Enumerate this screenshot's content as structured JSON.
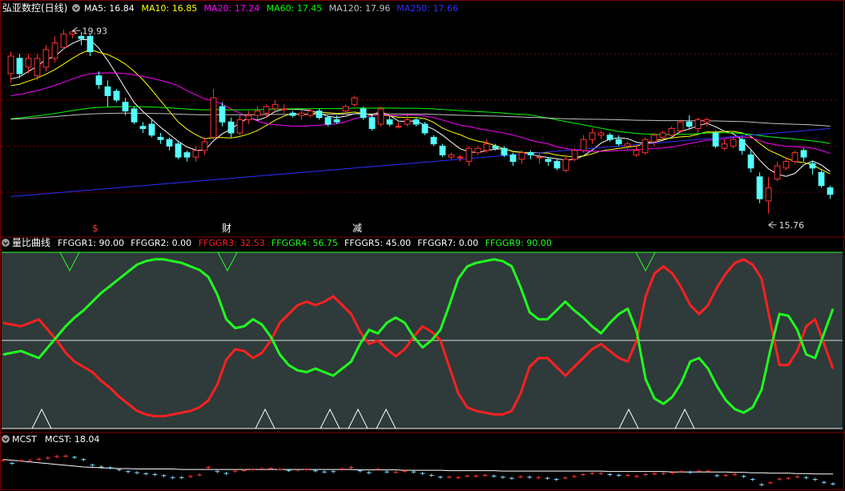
{
  "colors": {
    "up": "#ff3232",
    "down": "#54ffff",
    "ma5": "#ffffff",
    "ma10": "#ffff00",
    "ma20": "#ff00ff",
    "ma60": "#00ff00",
    "ma120": "#c0c0c0",
    "ma250": "#3030ff",
    "ffggr3": "#ff2020",
    "ffggr4": "#20ff20",
    "neutral": "#ffffff",
    "panel2_bg": "#2f3a3a",
    "border": "#800000"
  },
  "main": {
    "stock_name": "弘亚数控(日线)",
    "ma_labels": [
      {
        "label": "MA5: 16.84",
        "color": "#ffffff"
      },
      {
        "label": "MA10: 16.85",
        "color": "#ffff00"
      },
      {
        "label": "MA20: 17.24",
        "color": "#ff00ff"
      },
      {
        "label": "MA60: 17.45",
        "color": "#00ff00"
      },
      {
        "label": "MA120: 17.96",
        "color": "#c0c0c0"
      },
      {
        "label": "MA250: 17.66",
        "color": "#3030ff"
      }
    ],
    "high_label": "19.93",
    "low_label": "15.76",
    "markers": [
      {
        "label": "$",
        "color": "#ff3030"
      },
      {
        "label": "财",
        "color": "#ffffff"
      },
      {
        "label": "减",
        "color": "#ffffff"
      }
    ],
    "down_icon": "chevron-down-icon"
  },
  "indicator": {
    "title": "量比曲线",
    "labels": [
      {
        "label": "FFGGR1: 90.00",
        "color": "#ffffff"
      },
      {
        "label": "FFGGR2: 0.00",
        "color": "#ffffff"
      },
      {
        "label": "FFGGR3: 32.53",
        "color": "#ff2020"
      },
      {
        "label": "FFGGR4: 56.75",
        "color": "#20ff20"
      },
      {
        "label": "FFGGR5: 45.00",
        "color": "#ffffff"
      },
      {
        "label": "FFGGR7: 0.00",
        "color": "#ffffff"
      },
      {
        "label": "FFGGR9: 90.00",
        "color": "#20ff20"
      }
    ]
  },
  "mcst": {
    "title": "MCST",
    "value_label": "MCST: 18.04"
  },
  "chart_data": [
    {
      "type": "candlestick",
      "ylim": [
        15.3,
        20.3
      ],
      "high": 19.93,
      "low": 15.76,
      "candles": [
        [
          18.95,
          19.35,
          19.45,
          18.75
        ],
        [
          19.3,
          18.95,
          19.4,
          18.85
        ],
        [
          19.1,
          19.3,
          19.4,
          18.95
        ],
        [
          18.9,
          19.3,
          19.4,
          18.8
        ],
        [
          19.1,
          19.5,
          19.6,
          19.0
        ],
        [
          19.3,
          19.65,
          19.8,
          19.2
        ],
        [
          19.55,
          19.85,
          19.95,
          19.5
        ],
        [
          19.85,
          19.9,
          19.93,
          19.75
        ],
        [
          19.8,
          19.75,
          19.9,
          19.6
        ],
        [
          19.8,
          19.45,
          19.85,
          19.35
        ],
        [
          18.9,
          18.7,
          19.0,
          18.6
        ],
        [
          18.65,
          18.45,
          18.8,
          18.2
        ],
        [
          18.55,
          18.35,
          18.6,
          18.3
        ],
        [
          18.3,
          18.1,
          18.4,
          18.0
        ],
        [
          18.15,
          17.85,
          18.2,
          17.8
        ],
        [
          17.75,
          17.7,
          17.85,
          17.6
        ],
        [
          17.8,
          17.55,
          17.9,
          17.5
        ],
        [
          17.5,
          17.45,
          17.6,
          17.35
        ],
        [
          17.45,
          17.3,
          17.5,
          17.2
        ],
        [
          17.35,
          17.05,
          17.4,
          17.0
        ],
        [
          17.15,
          17.05,
          17.2,
          16.95
        ],
        [
          17.05,
          17.2,
          17.3,
          16.95
        ],
        [
          17.2,
          17.4,
          17.5,
          17.1
        ],
        [
          17.5,
          18.4,
          18.6,
          17.45
        ],
        [
          18.2,
          17.85,
          18.3,
          17.75
        ],
        [
          17.85,
          17.6,
          17.95,
          17.5
        ],
        [
          17.6,
          17.9,
          18.0,
          17.55
        ],
        [
          17.9,
          18.0,
          18.1,
          17.8
        ],
        [
          18.0,
          18.1,
          18.2,
          17.9
        ],
        [
          18.05,
          18.2,
          18.25,
          17.95
        ],
        [
          18.15,
          18.25,
          18.35,
          18.05
        ],
        [
          18.15,
          18.15,
          18.25,
          18.05
        ],
        [
          18.05,
          18.0,
          18.1,
          17.95
        ],
        [
          18.0,
          18.05,
          18.1,
          17.9
        ],
        [
          18.0,
          18.1,
          18.15,
          17.95
        ],
        [
          18.1,
          17.95,
          18.15,
          17.9
        ],
        [
          17.95,
          17.8,
          18.0,
          17.75
        ],
        [
          17.9,
          17.85,
          18.0,
          17.8
        ],
        [
          18.1,
          18.2,
          18.25,
          18.05
        ],
        [
          18.25,
          18.4,
          18.45,
          18.2
        ],
        [
          18.15,
          17.95,
          18.2,
          17.9
        ],
        [
          17.95,
          17.7,
          18.0,
          17.65
        ],
        [
          17.8,
          18.15,
          18.2,
          17.75
        ],
        [
          17.9,
          17.8,
          18.0,
          17.75
        ],
        [
          17.75,
          17.75,
          17.85,
          17.7
        ],
        [
          17.8,
          17.9,
          18.0,
          17.75
        ],
        [
          17.9,
          17.8,
          17.95,
          17.75
        ],
        [
          17.8,
          17.6,
          17.85,
          17.55
        ],
        [
          17.5,
          17.35,
          17.55,
          17.3
        ],
        [
          17.3,
          17.1,
          17.35,
          17.05
        ],
        [
          17.05,
          17.1,
          17.15,
          17.0
        ],
        [
          17.05,
          17.05,
          17.1,
          16.95
        ],
        [
          16.95,
          17.25,
          17.3,
          16.85
        ],
        [
          17.15,
          17.25,
          17.3,
          17.1
        ],
        [
          17.2,
          17.35,
          17.45,
          17.15
        ],
        [
          17.3,
          17.25,
          17.35,
          17.2
        ],
        [
          17.25,
          17.1,
          17.3,
          17.05
        ],
        [
          17.1,
          16.95,
          17.15,
          16.85
        ],
        [
          17.0,
          17.15,
          17.2,
          16.9
        ],
        [
          17.15,
          17.1,
          17.2,
          17.0
        ],
        [
          17.05,
          17.05,
          17.15,
          16.9
        ],
        [
          17.0,
          16.95,
          17.05,
          16.85
        ],
        [
          16.95,
          16.8,
          17.0,
          16.75
        ],
        [
          16.75,
          17.0,
          17.1,
          16.7
        ],
        [
          17.0,
          17.2,
          17.25,
          16.95
        ],
        [
          17.2,
          17.45,
          17.55,
          17.15
        ],
        [
          17.45,
          17.6,
          17.7,
          17.35
        ],
        [
          17.55,
          17.6,
          17.65,
          17.45
        ],
        [
          17.55,
          17.45,
          17.6,
          17.4
        ],
        [
          17.45,
          17.35,
          17.55,
          17.3
        ],
        [
          17.3,
          17.35,
          17.4,
          17.2
        ],
        [
          17.1,
          17.2,
          17.3,
          17.05
        ],
        [
          17.15,
          17.45,
          17.5,
          17.1
        ],
        [
          17.4,
          17.55,
          17.6,
          17.3
        ],
        [
          17.5,
          17.6,
          17.65,
          17.45
        ],
        [
          17.55,
          17.7,
          17.75,
          17.5
        ],
        [
          17.65,
          17.85,
          17.9,
          17.6
        ],
        [
          17.85,
          17.75,
          18.0,
          17.7
        ],
        [
          17.7,
          17.9,
          17.95,
          17.6
        ],
        [
          17.85,
          17.9,
          17.95,
          17.75
        ],
        [
          17.6,
          17.3,
          17.65,
          17.25
        ],
        [
          17.25,
          17.35,
          17.45,
          17.2
        ],
        [
          17.3,
          17.45,
          17.5,
          17.25
        ],
        [
          17.45,
          17.2,
          17.5,
          17.1
        ],
        [
          17.1,
          16.8,
          17.2,
          16.7
        ],
        [
          16.6,
          16.1,
          16.7,
          16.0
        ],
        [
          16.05,
          16.35,
          16.6,
          15.76
        ],
        [
          16.55,
          16.85,
          16.95,
          16.5
        ],
        [
          16.8,
          16.95,
          17.05,
          16.75
        ],
        [
          16.95,
          17.15,
          17.2,
          16.9
        ],
        [
          17.2,
          17.05,
          17.25,
          16.95
        ],
        [
          16.9,
          16.8,
          16.95,
          16.65
        ],
        [
          16.7,
          16.4,
          16.75,
          16.35
        ],
        [
          16.35,
          16.2,
          16.4,
          16.1
        ]
      ]
    },
    {
      "type": "line",
      "ylim": [
        0,
        100
      ],
      "series": [
        {
          "name": "FFGGR3",
          "values": [
            60,
            59,
            58,
            60,
            62,
            56,
            50,
            43,
            38,
            35,
            32,
            27,
            23,
            18,
            14,
            10,
            8,
            7,
            7,
            8,
            9,
            10,
            12,
            16,
            25,
            39,
            45,
            44,
            40,
            43,
            50,
            60,
            65,
            70,
            72,
            70,
            72,
            75,
            70,
            65,
            55,
            48,
            50,
            45,
            41,
            45,
            52,
            58,
            55,
            50,
            35,
            20,
            12,
            10,
            9,
            8,
            8,
            10,
            20,
            35,
            40,
            40,
            35,
            30,
            35,
            40,
            45,
            48,
            44,
            40,
            38,
            50,
            75,
            88,
            92,
            88,
            80,
            70,
            65,
            70,
            80,
            88,
            94,
            96,
            93,
            85,
            60,
            36,
            36,
            44,
            58,
            62,
            48,
            34
          ]
        },
        {
          "name": "FFGGR4",
          "values": [
            42,
            43,
            44,
            42,
            40,
            46,
            52,
            58,
            63,
            67,
            72,
            77,
            81,
            85,
            89,
            93,
            95,
            96,
            96,
            95,
            94,
            92,
            90,
            86,
            76,
            62,
            57,
            58,
            62,
            59,
            52,
            42,
            36,
            33,
            32,
            34,
            32,
            30,
            34,
            38,
            48,
            56,
            54,
            60,
            63,
            60,
            52,
            46,
            50,
            56,
            70,
            85,
            92,
            94,
            95,
            96,
            95,
            92,
            80,
            66,
            62,
            62,
            67,
            72,
            67,
            63,
            58,
            54,
            60,
            65,
            68,
            55,
            28,
            17,
            14,
            18,
            26,
            38,
            40,
            34,
            24,
            16,
            11,
            9,
            12,
            22,
            45,
            65,
            64,
            56,
            42,
            40,
            54,
            68
          ]
        }
      ]
    },
    {
      "type": "line",
      "ylim": [
        0,
        100
      ],
      "series": [
        {
          "name": "MCST",
          "values": [
            70,
            68,
            66,
            64,
            62,
            60,
            58,
            56,
            54,
            52,
            51,
            50,
            49,
            48,
            48,
            47,
            47,
            47,
            47,
            47,
            46,
            46,
            46,
            46,
            46,
            46,
            46,
            46,
            46,
            46,
            46,
            46,
            46,
            46,
            46,
            46,
            46,
            46,
            46,
            46,
            45,
            45,
            45,
            45,
            45,
            44,
            44,
            44,
            44,
            44,
            43,
            43,
            43,
            43,
            43,
            43,
            42,
            42,
            42,
            42,
            42,
            42,
            42,
            42,
            42,
            42,
            42,
            42,
            41,
            41,
            41,
            41,
            41,
            41,
            41,
            40,
            40,
            40,
            40,
            40,
            40,
            40,
            39,
            39,
            38,
            38,
            37,
            37,
            37,
            36,
            36,
            35,
            35,
            35
          ]
        }
      ]
    }
  ]
}
